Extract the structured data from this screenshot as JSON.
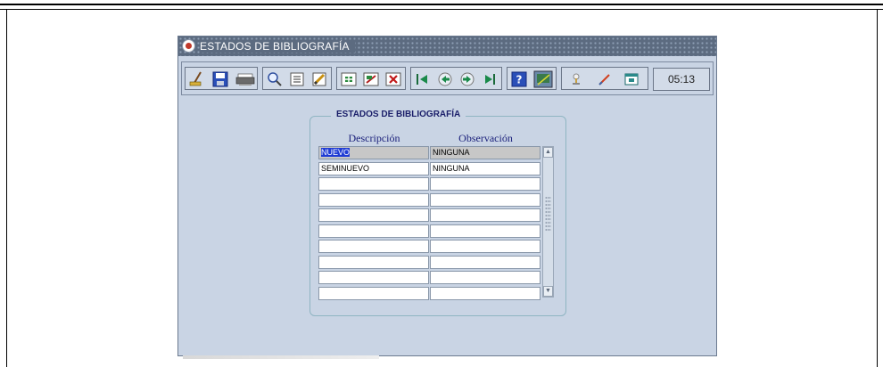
{
  "window": {
    "title": "ESTADOS DE BIBLIOGRAFÍA"
  },
  "toolbar": {
    "clock": "05:13",
    "buttons": [
      {
        "name": "clear-icon"
      },
      {
        "name": "save-icon"
      },
      {
        "name": "print-icon"
      },
      {
        "name": "query-icon"
      },
      {
        "name": "list-icon"
      },
      {
        "name": "edit-icon"
      },
      {
        "name": "insert-record-icon"
      },
      {
        "name": "duplicate-record-icon"
      },
      {
        "name": "delete-record-icon"
      },
      {
        "name": "first-record-icon"
      },
      {
        "name": "previous-record-icon"
      },
      {
        "name": "next-record-icon"
      },
      {
        "name": "last-record-icon"
      },
      {
        "name": "help-icon"
      },
      {
        "name": "exit-icon"
      },
      {
        "name": "tool-a-icon"
      },
      {
        "name": "tool-b-icon"
      },
      {
        "name": "tool-c-icon"
      }
    ]
  },
  "block": {
    "title": "ESTADOS DE BIBLIOGRAFÍA",
    "columns": [
      "Descripción",
      "Observación"
    ],
    "rows": [
      {
        "descripcion": "NUEVO",
        "observacion": "NINGUNA"
      },
      {
        "descripcion": "SEMINUEVO",
        "observacion": "NINGUNA"
      },
      {
        "descripcion": "",
        "observacion": ""
      },
      {
        "descripcion": "",
        "observacion": ""
      },
      {
        "descripcion": "",
        "observacion": ""
      },
      {
        "descripcion": "",
        "observacion": ""
      },
      {
        "descripcion": "",
        "observacion": ""
      },
      {
        "descripcion": "",
        "observacion": ""
      },
      {
        "descripcion": "",
        "observacion": ""
      },
      {
        "descripcion": "",
        "observacion": ""
      }
    ]
  },
  "colors": {
    "window_bg": "#c9d4e4",
    "title_bar": "#5c6b80",
    "heading_text": "#1b1f6a",
    "selection": "#1f3cd4"
  }
}
